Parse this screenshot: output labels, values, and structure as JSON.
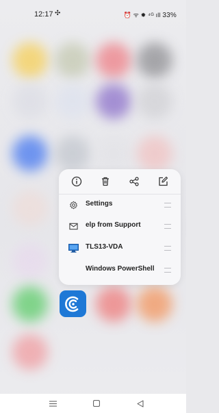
{
  "status_bar": {
    "time": "12:17",
    "right_text": "ᯤ ✹ ⁴ᴳ",
    "signal": "ıll",
    "battery": "33%"
  },
  "quick_actions": [
    {
      "name": "info-icon"
    },
    {
      "name": "delete-icon"
    },
    {
      "name": "share-icon"
    },
    {
      "name": "edit-icon"
    }
  ],
  "shortcuts": [
    {
      "icon": "gear-icon",
      "label": "Settings"
    },
    {
      "icon": "mail-icon",
      "label": "elp from Support"
    },
    {
      "icon": "monitor-icon",
      "label": "TLS13-VDA"
    },
    {
      "icon": "",
      "label": "Windows PowerShell"
    }
  ],
  "app": {
    "icon": "citrix-workspace-icon"
  },
  "nav": {
    "menu": "☰",
    "home": "▢",
    "back": "◁"
  },
  "colors": {
    "accent": "#1e78d6",
    "menu_bg": "#f7f7f9"
  }
}
